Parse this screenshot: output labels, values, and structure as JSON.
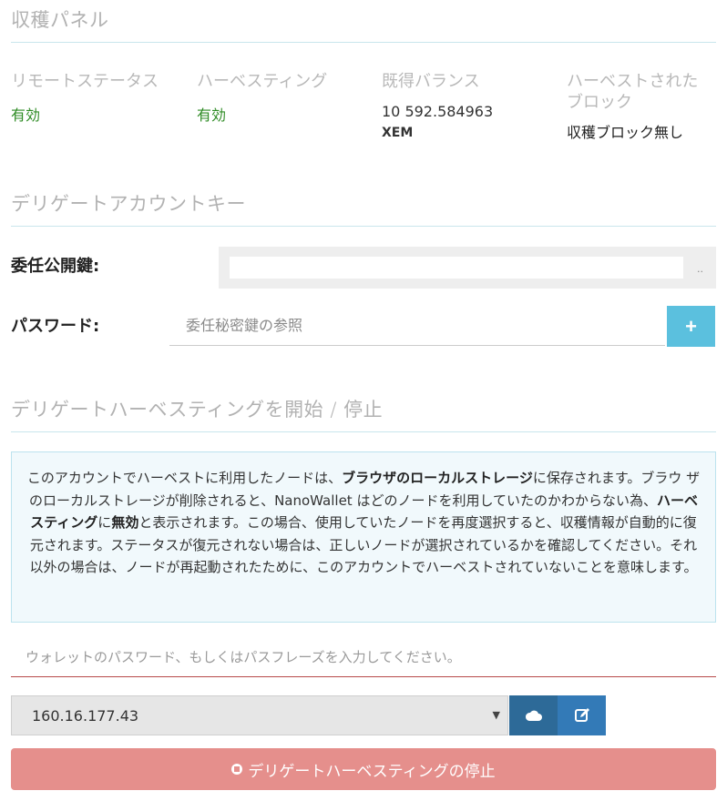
{
  "harvest_panel": {
    "title": "収穫パネル",
    "remote_status": {
      "label": "リモートステータス",
      "value": "有効"
    },
    "harvesting": {
      "label": "ハーベスティング",
      "value": "有効"
    },
    "vested_balance": {
      "label": "既得バランス",
      "amount": "10 592.584963",
      "unit": "XEM"
    },
    "harvested_blocks": {
      "label": "ハーベストされたブロック",
      "value": "収穫ブロック無し"
    }
  },
  "delegate_key": {
    "title": "デリゲートアカウントキー",
    "public_key_label": "委任公開鍵:",
    "public_key_overflow": "..",
    "password_label": "パスワード:",
    "password_placeholder": "委任秘密鍵の参照",
    "add_label": "+"
  },
  "delegate_harvesting": {
    "title": "デリゲートハーベスティングを開始 / 停止",
    "info": {
      "p1": "このアカウントでハーベストに利用したノードは、",
      "b1": "ブラウザのローカルストレージ",
      "p2": "に保存されます。ブラウ ザのローカルストレージが削除されると、NanoWallet はどのノードを利用していたのかわからない為、",
      "b2": "ハーベスティング",
      "p3": "に",
      "b3": "無効",
      "p4": "と表示されます。この場合、使用していたノードを再度選択すると、収穫情報が自動的に復元されます。ステータスが復元されない場合は、正しいノードが選択されているかを確認してください。それ以外の場合は、ノードが再起動されたために、このアカウントでハーベストされていないことを意味します。"
    },
    "wallet_password_placeholder": "ウォレットのパスワード、もしくはパスフレーズを入力してください。",
    "node": "160.16.177.43",
    "stop_button": "デリゲートハーベスティングの停止"
  }
}
